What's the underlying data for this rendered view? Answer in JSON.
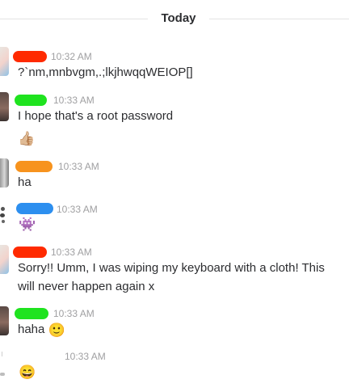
{
  "divider": {
    "label": "Today"
  },
  "messages": [
    {
      "time": "10:32 AM",
      "name_color": "#ff2a00",
      "text": "?`nm,mnbvgm,.;lkjhwqqWEIOP[]"
    },
    {
      "time": "10:33 AM",
      "name_color": "#1fe31f",
      "text": "I hope that's a root password",
      "reaction_emoji": "👍🏼"
    },
    {
      "time": "10:33 AM",
      "name_color": "#f7931e",
      "text": "ha"
    },
    {
      "time": "10:33 AM",
      "name_color": "#2d8fef",
      "emoji": "👾"
    },
    {
      "time": "10:33 AM",
      "name_color": "#ff2a00",
      "text": "Sorry!! Umm, I was wiping my keyboard with a cloth! This will never happen again x"
    },
    {
      "time": "10:33 AM",
      "name_color": "#1fe31f",
      "text": "haha",
      "inline_emoji": "🙂"
    },
    {
      "time": "10:33 AM",
      "emoji": "😄"
    }
  ]
}
